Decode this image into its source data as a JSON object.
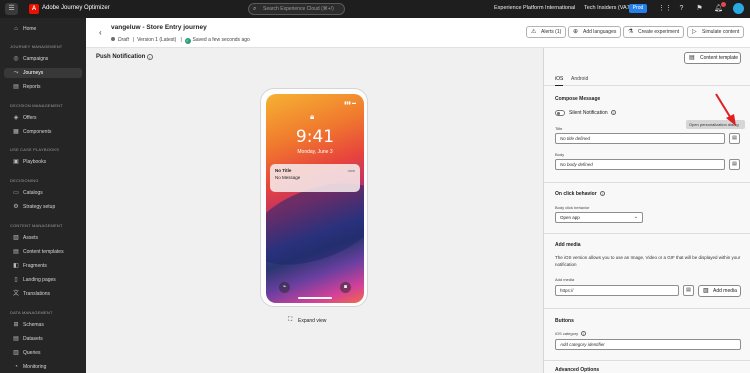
{
  "app": {
    "name": "Adobe Journey Optimizer",
    "logo_letter": "A"
  },
  "topbar": {
    "search_placeholder": "Search Experience Cloud (⌘+/)",
    "org": "Experience Platform International",
    "sandbox": "Tech Insiders (VA7)",
    "env": "Prod",
    "notifications_count": "1"
  },
  "sidebar": {
    "home": "Home",
    "sections": {
      "journey": "JOURNEY MANAGEMENT",
      "decision": "DECISION MANAGEMENT",
      "usecase": "USE CASE PLAYBOOKS",
      "decisioning": "DECISIONING",
      "content": "CONTENT MANAGEMENT",
      "data": "DATA MANAGEMENT"
    },
    "items": {
      "campaigns": "Campaigns",
      "journeys": "Journeys",
      "reports": "Reports",
      "offers": "Offers",
      "components": "Components",
      "playbooks": "Playbooks",
      "catalogs": "Catalogs",
      "strategy": "Strategy setup",
      "assets": "Assets",
      "content_templates": "Content templates",
      "fragments": "Fragments",
      "landing_pages": "Landing pages",
      "translations": "Translations",
      "schemas": "Schemas",
      "datasets": "Datasets",
      "queries": "Queries",
      "monitoring": "Monitoring"
    }
  },
  "header": {
    "title": "vangeluw - Store Entry journey",
    "status": "Draft",
    "version": "Version 1 (Latest)",
    "saved": "Saved a few seconds ago",
    "alerts": "Alerts (1)",
    "add_languages": "Add languages",
    "create_experiment": "Create experiment",
    "simulate_content": "Simulate content"
  },
  "main": {
    "title": "Push Notification",
    "expand_view": "Expand view",
    "phone": {
      "time": "9:41",
      "date": "Monday, June 3",
      "notif_title": "No Title",
      "notif_message": "No Message",
      "notif_time": "now"
    }
  },
  "panel": {
    "content_template": "Content template",
    "tabs": [
      "iOS",
      "Android"
    ],
    "compose": {
      "title": "Compose Message",
      "silent": "Silent Notification",
      "title_label": "Title",
      "title_value": "No title defined",
      "body_label": "Body",
      "body_value": "No body defined",
      "tooltip": "Open personalization dialog"
    },
    "onclick": {
      "title": "On click behavior",
      "label": "Body click behavior",
      "value": "Open app"
    },
    "media": {
      "title": "Add media",
      "description": "The iOS version allows you to use an Image, Video or a GIF that will be displayed within your notification",
      "label": "Add media",
      "value": "https://",
      "button": "Add media"
    },
    "buttons": {
      "title": "Buttons",
      "category_label": "iOS category",
      "category_placeholder": "Add category identifier"
    },
    "advanced": "Advanced Options"
  }
}
